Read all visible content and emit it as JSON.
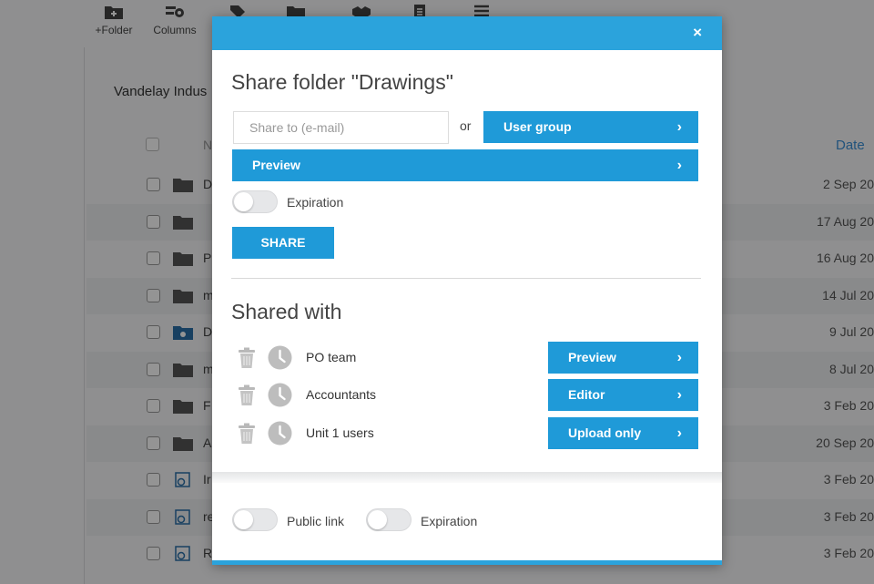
{
  "toolbar": [
    {
      "label": "+Folder",
      "icon": "folder-plus-icon"
    },
    {
      "label": "Columns",
      "icon": "columns-icon"
    },
    {
      "label": "",
      "icon": "tag-icon"
    },
    {
      "label": "",
      "icon": "folder-settings-icon"
    },
    {
      "label": "",
      "icon": "handshake-icon"
    },
    {
      "label": "",
      "icon": "document-icon"
    },
    {
      "label": "",
      "icon": "list-icon"
    }
  ],
  "breadcrumb": "Vandelay Indus",
  "file_list": {
    "name_header": "N",
    "date_header": "Date",
    "rows": [
      {
        "name": "D",
        "date": "2 Sep 20",
        "icon": "folder-icon"
      },
      {
        "name": "",
        "date": "17 Aug 20",
        "icon": "folder-icon"
      },
      {
        "name": "P",
        "date": "16 Aug 20",
        "icon": "folder-icon"
      },
      {
        "name": "m",
        "date": "14 Jul 20",
        "icon": "folder-icon"
      },
      {
        "name": "D",
        "date": "9 Jul 20",
        "icon": "shared-folder-icon"
      },
      {
        "name": "m",
        "date": "8 Jul 20",
        "icon": "folder-icon"
      },
      {
        "name": "F",
        "date": "3 Feb 20",
        "icon": "folder-icon"
      },
      {
        "name": "A",
        "date": "20 Sep 20",
        "icon": "folder-icon"
      },
      {
        "name": "Ir",
        "date": "3 Feb 20",
        "icon": "image-file-icon"
      },
      {
        "name": "re",
        "date": "3 Feb 20",
        "icon": "image-file-icon"
      },
      {
        "name": "R",
        "date": "3 Feb 20",
        "icon": "image-file-icon"
      }
    ]
  },
  "dialog": {
    "close": "×",
    "title": "Share folder \"Drawings\"",
    "email_placeholder": "Share to (e-mail)",
    "or": "or",
    "user_group": "User group",
    "preview": "Preview",
    "expiration": "Expiration",
    "share": "SHARE",
    "shared_with_title": "Shared with",
    "shared_with": [
      {
        "name": "PO team",
        "permission": "Preview"
      },
      {
        "name": "Accountants",
        "permission": "Editor"
      },
      {
        "name": "Unit 1 users",
        "permission": "Upload only"
      }
    ],
    "public_link": "Public link",
    "footer_expiration": "Expiration",
    "chevron": "›"
  },
  "colors": {
    "accent": "#2ba3dc",
    "button": "#1f9ad8"
  }
}
